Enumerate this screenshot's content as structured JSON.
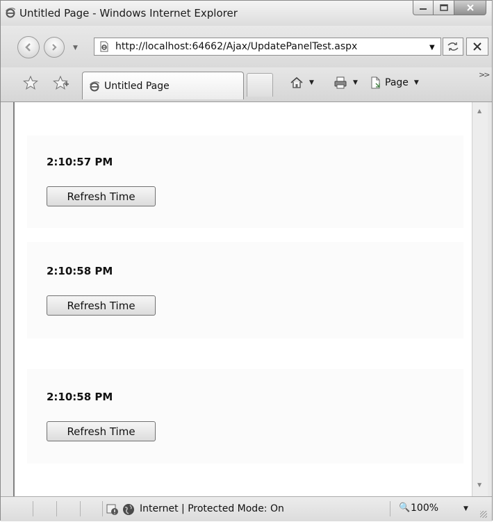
{
  "window": {
    "title": "Untitled Page - Windows Internet Explorer",
    "controls": [
      "minimize-icon",
      "maximize-icon",
      "close-icon"
    ]
  },
  "navigation": {
    "address": "http://localhost:64662/Ajax/UpdatePanelTest.aspx",
    "icons": [
      "back-icon",
      "forward-icon",
      "refresh-icon",
      "stop-icon"
    ]
  },
  "tabs": {
    "active_tab": "Untitled Page",
    "page_menu": "Page"
  },
  "panels": [
    {
      "time": "2:10:57 PM",
      "button": "Refresh Time"
    },
    {
      "time": "2:10:58 PM",
      "button": "Refresh Time"
    },
    {
      "time": "2:10:58 PM",
      "button": "Refresh Time"
    }
  ],
  "status": {
    "zone": "Internet | Protected Mode: On",
    "zoom": "100%"
  },
  "colors": {
    "chrome": "#dcdcdc",
    "panel_background": "#fbfbfb",
    "window_border": "#8a8a8a"
  }
}
